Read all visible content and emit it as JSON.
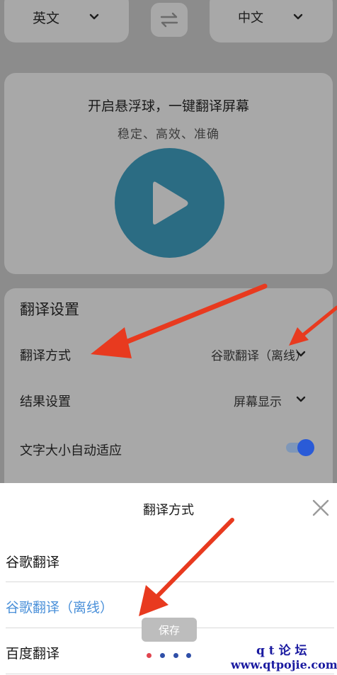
{
  "lang_bar": {
    "source": "英文",
    "target": "中文",
    "swap_icon": "swap-arrows-icon",
    "dropdown_icon": "chevron-down-icon"
  },
  "float_card": {
    "title": "开启悬浮球，一键翻译屏幕",
    "subtitle": "稳定、高效、准确",
    "play_icon": "play-icon"
  },
  "settings": {
    "heading": "翻译设置",
    "rows": [
      {
        "label": "翻译方式",
        "value": "谷歌翻译（离线）"
      },
      {
        "label": "结果设置",
        "value": "屏幕显示"
      },
      {
        "label": "文字大小自动适应",
        "toggle_on": true
      }
    ]
  },
  "sheet": {
    "title": "翻译方式",
    "close_icon": "close-icon",
    "options": [
      {
        "label": "谷歌翻译",
        "selected": false
      },
      {
        "label": "谷歌翻译（离线）",
        "selected": true
      },
      {
        "label": "百度翻译",
        "selected": false
      }
    ]
  },
  "toast": {
    "text": "保存"
  },
  "watermark": {
    "line1": "q t 论 坛",
    "line2": "www.qtpojie.com"
  },
  "colors": {
    "overlay": "#8c8c8c",
    "card": "#a8a8a8",
    "play_circle": "#2b6c83",
    "selected_option": "#4a90d9",
    "toggle_knob": "#2a5bd7",
    "arrow_red": "#e83a1f",
    "watermark_blue": "#1a1aa0"
  }
}
